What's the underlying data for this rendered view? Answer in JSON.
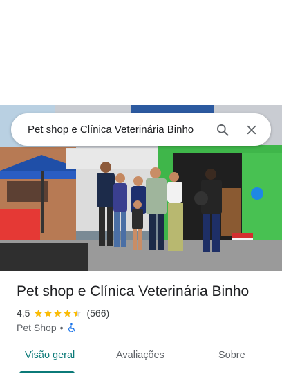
{
  "search": {
    "query": "Pet shop e Clínica Veterinária Binho"
  },
  "place": {
    "name": "Pet shop e Clínica Veterinária Binho",
    "rating": "4,5",
    "rating_value": 4.5,
    "review_count": "(566)",
    "category": "Pet Shop",
    "separator": "•"
  },
  "tabs": [
    {
      "label": "Visão geral",
      "active": true
    },
    {
      "label": "Avaliações",
      "active": false
    },
    {
      "label": "Sobre",
      "active": false
    }
  ],
  "colors": {
    "accent": "#0b7a78",
    "star": "#fbbc04",
    "accessibility": "#1a73e8"
  },
  "icons": {
    "search": "search-icon",
    "close": "close-icon",
    "accessibility": "wheelchair-icon"
  }
}
